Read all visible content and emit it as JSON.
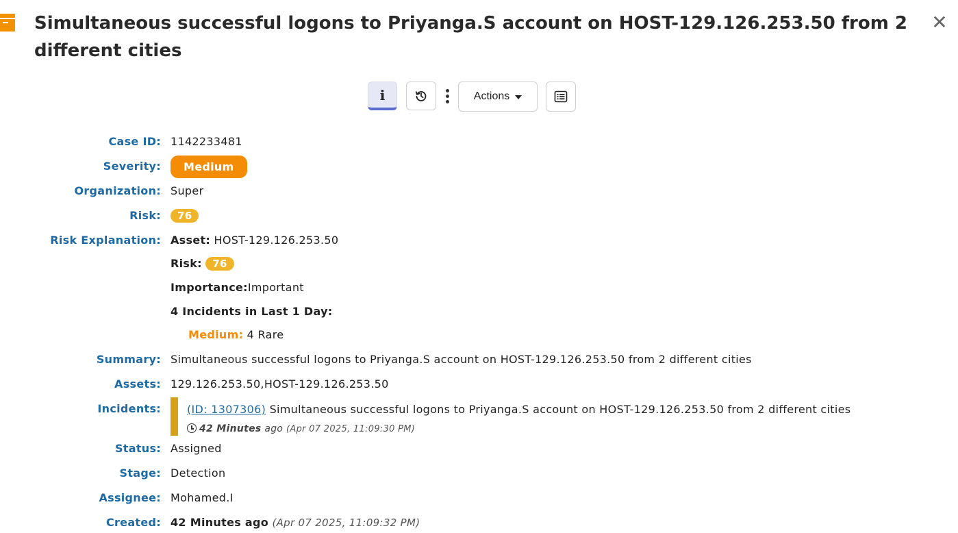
{
  "header": {
    "title": "Simultaneous successful logons to Priyanga.S account on HOST-129.126.253.50 from 2 different cities",
    "close_glyph": "✕",
    "icon": "case-box-icon"
  },
  "toolbar": {
    "info_label": "i",
    "actions_label": "Actions",
    "icons": [
      "info-icon",
      "history-icon",
      "more-vertical-icon",
      "caret-down-icon",
      "list-icon"
    ]
  },
  "fields": {
    "case_id": {
      "label": "Case ID:",
      "value": "1142233481"
    },
    "severity": {
      "label": "Severity:",
      "value": "Medium"
    },
    "organization": {
      "label": "Organization:",
      "value": "Super"
    },
    "risk": {
      "label": "Risk:",
      "value": "76"
    },
    "risk_explanation": {
      "label": "Risk Explanation:",
      "asset_label": "Asset:",
      "asset_value": "HOST-129.126.253.50",
      "risk_label": "Risk:",
      "risk_value": "76",
      "importance_label": "Importance:",
      "importance_value": "Important",
      "incidents_heading": "4 Incidents in Last 1 Day:",
      "breakdown_level": "Medium:",
      "breakdown_value": "4 Rare"
    },
    "summary": {
      "label": "Summary:",
      "value": "Simultaneous successful logons to Priyanga.S account on HOST-129.126.253.50 from 2 different cities"
    },
    "assets": {
      "label": "Assets:",
      "value": "129.126.253.50,HOST-129.126.253.50"
    },
    "incidents": {
      "label": "Incidents:",
      "items": [
        {
          "id_link": "(ID: 1307306)",
          "text": "Simultaneous successful logons to Priyanga.S account on HOST-129.126.253.50 from 2 different cities",
          "relative_time": "42 Minutes",
          "ago": "ago",
          "timestamp": "(Apr 07 2025, 11:09:30 PM)"
        }
      ]
    },
    "status": {
      "label": "Status:",
      "value": "Assigned"
    },
    "stage": {
      "label": "Stage:",
      "value": "Detection"
    },
    "assignee": {
      "label": "Assignee:",
      "value": "Mohamed.I"
    },
    "created": {
      "label": "Created:",
      "relative": "42 Minutes ago",
      "timestamp": "(Apr 07 2025, 11:09:32 PM)"
    }
  },
  "colors": {
    "label_blue": "#1f6aa2",
    "severity_orange": "#f48c06",
    "risk_yellow": "#f0b429",
    "incident_bar": "#d4a017",
    "active_tab": "#5b6bd0"
  }
}
